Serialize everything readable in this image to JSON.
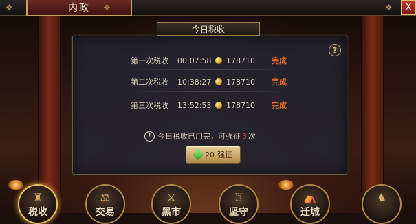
{
  "header": {
    "title": "内政",
    "close_label": "X"
  },
  "panel": {
    "title": "今日税收",
    "help_label": "?",
    "records": [
      {
        "label": "第一次税收",
        "time": "00:07:58",
        "amount": "178710",
        "status": "完成"
      },
      {
        "label": "第二次税收",
        "time": "10:38:27",
        "amount": "178710",
        "status": "完成"
      },
      {
        "label": "第三次税收",
        "time": "13:52:53",
        "amount": "178710",
        "status": "完成"
      }
    ],
    "notice": {
      "prefix": "今日税收已用完，可强征",
      "count": "3",
      "suffix": "次"
    },
    "force_button": {
      "cost": "20",
      "label": "强征"
    }
  },
  "nav": {
    "items": [
      {
        "label": "税收",
        "icon": "tax-icon"
      },
      {
        "label": "交易",
        "icon": "trade-icon"
      },
      {
        "label": "黑市",
        "icon": "blackmarket-icon"
      },
      {
        "label": "坚守",
        "icon": "defend-icon"
      },
      {
        "label": "迁城",
        "icon": "relocate-icon"
      },
      {
        "label": "",
        "icon": "caravan-icon"
      }
    ]
  },
  "colors": {
    "accent_gold": "#c9a15a",
    "done_orange": "#e06a2a",
    "highlight_red": "#e0442a"
  }
}
